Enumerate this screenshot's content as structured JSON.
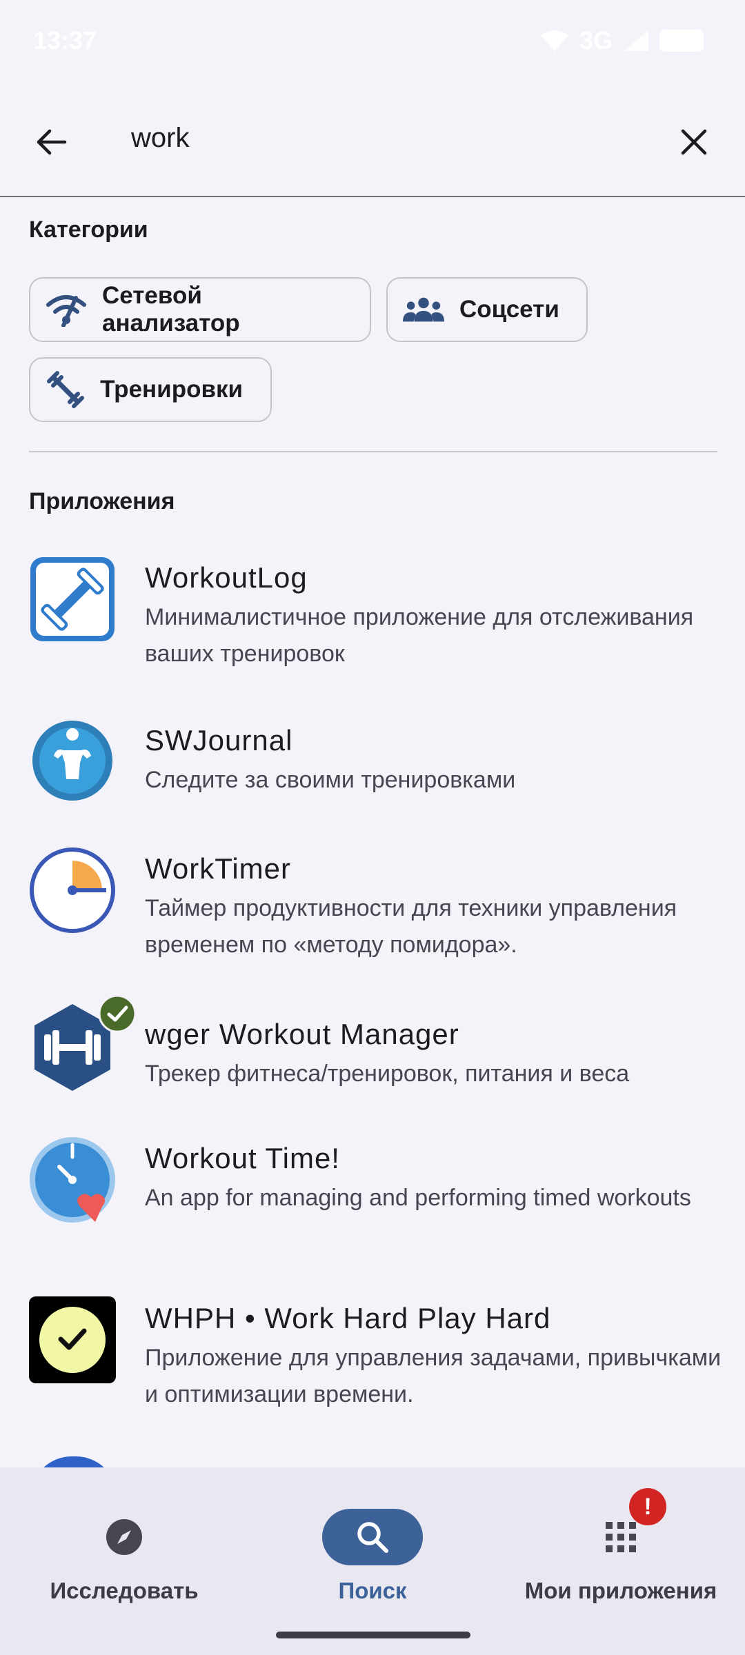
{
  "status_bar": {
    "time": "13:37",
    "network": "3G"
  },
  "search": {
    "query": "work"
  },
  "categories": {
    "title": "Категории",
    "chips": [
      {
        "label": "Сетевой анализатор",
        "icon": "network-analyzer-icon"
      },
      {
        "label": "Соцсети",
        "icon": "people-icon"
      },
      {
        "label": "Тренировки",
        "icon": "dumbbell-icon"
      }
    ]
  },
  "apps": {
    "title": "Приложения",
    "items": [
      {
        "name": "WorkoutLog",
        "description": "Минималистичное приложение для отслеживания ваших тренировок",
        "installed": false
      },
      {
        "name": "SWJournal",
        "description": "Следите за своими тренировками",
        "installed": false
      },
      {
        "name": "WorkTimer",
        "description": "Таймер продуктивности для техники управления временем по «методу помидора».",
        "installed": false
      },
      {
        "name": "wger Workout Manager",
        "description": "Трекер фитнеса/тренировок, питания и веса",
        "installed": true
      },
      {
        "name": "Workout Time!",
        "description": "An app for managing and performing timed workouts",
        "installed": false
      },
      {
        "name": "WHPH • Work Hard Play Hard",
        "description": "Приложение для управления задачами, привычками и оптимизации времени.",
        "installed": false
      }
    ]
  },
  "bottom_nav": {
    "items": [
      {
        "label": "Исследовать",
        "icon": "compass-icon",
        "active": false
      },
      {
        "label": "Поиск",
        "icon": "search-icon",
        "active": true
      },
      {
        "label": "Мои приложения",
        "icon": "apps-grid-icon",
        "active": false,
        "badge": "!"
      }
    ]
  },
  "colors": {
    "accent": "#3d6299",
    "badge": "#d32424",
    "installed_check": "#4a6a2a"
  }
}
